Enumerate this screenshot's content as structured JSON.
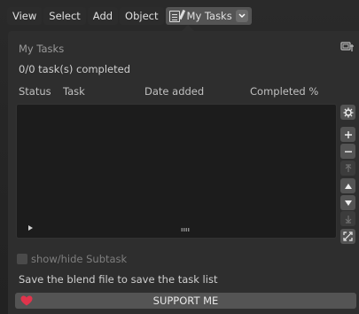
{
  "menubar": {
    "items": [
      "View",
      "Select",
      "Add",
      "Object"
    ],
    "active_tab": "My Tasks"
  },
  "panel": {
    "title": "My Tasks",
    "progress": "0/0 task(s) completed",
    "columns": [
      "Status",
      "Task",
      "Date added",
      "Completed %"
    ],
    "tasks": [],
    "subtask_toggle_label": "show/hide Subtask",
    "subtask_toggle_checked": false,
    "save_note": "Save the blend file to save the task list",
    "support_label": "SUPPORT ME"
  },
  "icons": {
    "tab_icon": "tasks-icon",
    "pin": "pin-icon",
    "side_buttons": [
      "settings-icon",
      "add-icon",
      "remove-icon",
      "move-top-icon",
      "move-up-icon",
      "move-down-icon",
      "move-bottom-icon",
      "fullscreen-icon"
    ]
  },
  "colors": {
    "panel_bg": "#2e2e2e",
    "list_bg": "#1c1c1c",
    "button_bg": "#545454",
    "heart": "#e0344c"
  }
}
